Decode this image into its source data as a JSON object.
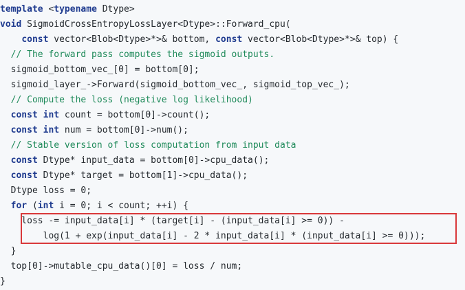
{
  "code_lines": [
    [
      {
        "t": "kw",
        "v": "template"
      },
      {
        "t": "tx",
        "v": " <"
      },
      {
        "t": "kw",
        "v": "typename"
      },
      {
        "t": "tx",
        "v": " Dtype>"
      }
    ],
    [
      {
        "t": "kw",
        "v": "void"
      },
      {
        "t": "tx",
        "v": " SigmoidCrossEntropyLossLayer<Dtype>::Forward_cpu("
      }
    ],
    [
      {
        "t": "tx",
        "v": "    "
      },
      {
        "t": "kw",
        "v": "const"
      },
      {
        "t": "tx",
        "v": " vector<Blob<Dtype>*>& bottom, "
      },
      {
        "t": "kw",
        "v": "const"
      },
      {
        "t": "tx",
        "v": " vector<Blob<Dtype>*>& top) {"
      }
    ],
    [
      {
        "t": "tx",
        "v": "  "
      },
      {
        "t": "cm",
        "v": "// The forward pass computes the sigmoid outputs."
      }
    ],
    [
      {
        "t": "tx",
        "v": "  sigmoid_bottom_vec_[0] = bottom[0];"
      }
    ],
    [
      {
        "t": "tx",
        "v": "  sigmoid_layer_->Forward(sigmoid_bottom_vec_, sigmoid_top_vec_);"
      }
    ],
    [
      {
        "t": "tx",
        "v": "  "
      },
      {
        "t": "cm",
        "v": "// Compute the loss (negative log likelihood)"
      }
    ],
    [
      {
        "t": "tx",
        "v": "  "
      },
      {
        "t": "kw",
        "v": "const"
      },
      {
        "t": "tx",
        "v": " "
      },
      {
        "t": "kw",
        "v": "int"
      },
      {
        "t": "tx",
        "v": " count = bottom[0]->count();"
      }
    ],
    [
      {
        "t": "tx",
        "v": "  "
      },
      {
        "t": "kw",
        "v": "const"
      },
      {
        "t": "tx",
        "v": " "
      },
      {
        "t": "kw",
        "v": "int"
      },
      {
        "t": "tx",
        "v": " num = bottom[0]->num();"
      }
    ],
    [
      {
        "t": "tx",
        "v": "  "
      },
      {
        "t": "cm",
        "v": "// Stable version of loss computation from input data"
      }
    ],
    [
      {
        "t": "tx",
        "v": "  "
      },
      {
        "t": "kw",
        "v": "const"
      },
      {
        "t": "tx",
        "v": " Dtype* input_data = bottom[0]->cpu_data();"
      }
    ],
    [
      {
        "t": "tx",
        "v": "  "
      },
      {
        "t": "kw",
        "v": "const"
      },
      {
        "t": "tx",
        "v": " Dtype* target = bottom[1]->cpu_data();"
      }
    ],
    [
      {
        "t": "tx",
        "v": "  Dtype loss = 0;"
      }
    ],
    [
      {
        "t": "tx",
        "v": "  "
      },
      {
        "t": "kw",
        "v": "for"
      },
      {
        "t": "tx",
        "v": " ("
      },
      {
        "t": "kw",
        "v": "int"
      },
      {
        "t": "tx",
        "v": " i = 0; i < count; ++i) {"
      }
    ],
    [
      {
        "t": "tx",
        "v": "    loss -= input_data[i] * (target[i] - (input_data[i] >= 0)) -"
      }
    ],
    [
      {
        "t": "tx",
        "v": "        log(1 + exp(input_data[i] - 2 * input_data[i] * (input_data[i] >= 0)));"
      }
    ],
    [
      {
        "t": "tx",
        "v": "  }"
      }
    ],
    [
      {
        "t": "tx",
        "v": "  top[0]->mutable_cpu_data()[0] = loss / num;"
      }
    ],
    [
      {
        "t": "tx",
        "v": "}"
      }
    ]
  ],
  "highlight": {
    "color": "#d9383a"
  }
}
